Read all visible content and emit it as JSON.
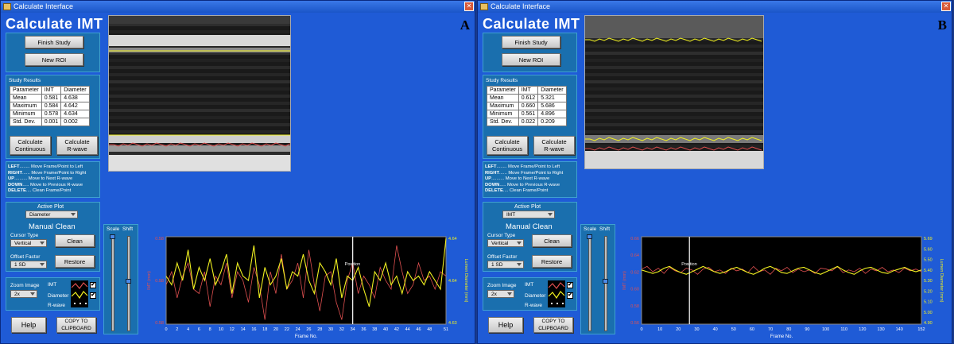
{
  "window": {
    "title": "Calculate Interface",
    "app_title": "Calculate IMT",
    "close_glyph": "✕"
  },
  "controls": {
    "finish_study": "Finish Study",
    "new_roi": "New ROI",
    "study_results": "Study Results",
    "calc_continuous_1": "Calculate",
    "calc_continuous_2": "Continuous",
    "calc_rwave_1": "Calculate",
    "calc_rwave_2": "R-wave",
    "active_plot": "Active Plot",
    "manual_clean": "Manual Clean",
    "cursor_type": "Cursor Type",
    "cursor_value": "Vertical",
    "clean": "Clean",
    "offset_factor": "Offset Factor",
    "offset_value": "1 SD",
    "restore": "Restore",
    "zoom_image": "Zoom Image",
    "zoom_value": "2x",
    "legend_imt": "IMT",
    "legend_diameter": "Diameter",
    "legend_rwave": "R-wave",
    "help": "Help",
    "copy_1": "COPY TO",
    "copy_2": "CLIPBOARD",
    "scale": "Scale",
    "shift": "Shift",
    "frame_label": "Frame No.",
    "imt_axis": "IMT (mm)",
    "lumen_axis": "Lumen Diameter (mm)",
    "position": "Position",
    "check": "✔"
  },
  "keys": [
    {
      "k": "LEFT",
      "d": "........ Move Frame/Point to Left"
    },
    {
      "k": "RIGHT",
      "d": "...... Move Frame/Point to Right"
    },
    {
      "k": "UP",
      "d": ".......... Move to Next R-wave"
    },
    {
      "k": "DOWN",
      "d": "..... Move to Previous R-wave"
    },
    {
      "k": "DELETE",
      "d": ".... Clean Frame/Point"
    }
  ],
  "colors": {
    "imt": "#e05050",
    "diameter": "#f0f020",
    "rwave": "#ffffff",
    "plot_bg": "#000000"
  },
  "panels": [
    {
      "letter": "A",
      "results_header": [
        "Parameter",
        "IMT",
        "Diameter"
      ],
      "results": [
        [
          "Mean",
          "0.581",
          "4.638"
        ],
        [
          "Maximum",
          "0.584",
          "4.642"
        ],
        [
          "Minimum",
          "0.578",
          "4.634"
        ],
        [
          "Std. Dev.",
          "0.001",
          "0.002"
        ]
      ],
      "active_plot_value": "Diameter",
      "chart_data": {
        "type": "line",
        "xlabel": "Frame No.",
        "ylabel": "IMT (mm)",
        "y2label": "Lumen Diameter (mm)",
        "xlim": [
          0,
          51
        ],
        "ylim": [
          0.58,
          0.58
        ],
        "y_ticks_left": [
          "0.58",
          "0.58",
          "0.58"
        ],
        "y_ticks_right": [
          "4.64",
          "4.64",
          "4.63"
        ],
        "x_ticks": [
          0,
          2,
          4,
          6,
          8,
          10,
          12,
          14,
          16,
          18,
          20,
          22,
          24,
          26,
          28,
          30,
          32,
          34,
          36,
          38,
          40,
          42,
          44,
          46,
          48,
          51
        ],
        "cursor_x": 34,
        "series": [
          {
            "name": "IMT",
            "color": "#e05050",
            "values": [
              0.45,
              0.6,
              0.3,
              0.55,
              0.7,
              0.4,
              0.35,
              0.6,
              0.2,
              0.55,
              0.45,
              0.7,
              0.3,
              0.6,
              0.5,
              0.25,
              0.65,
              0.45,
              0.05,
              0.6,
              0.35,
              0.8,
              0.4,
              0.5,
              0.7,
              0.3,
              0.85,
              0.45,
              0.15,
              0.55,
              0.6,
              0.25,
              0.05,
              0.5,
              0.7,
              0.35,
              0.55,
              0.45,
              0.3,
              0.65,
              0.5,
              0.4,
              0.9,
              0.6,
              0.35,
              0.45,
              0.7,
              0.5,
              0.55,
              0.4,
              0.6,
              0.55
            ]
          },
          {
            "name": "Diameter",
            "color": "#f0f020",
            "values": [
              0.55,
              0.45,
              0.7,
              0.5,
              0.85,
              0.4,
              0.65,
              0.5,
              0.75,
              0.45,
              0.6,
              0.8,
              0.35,
              0.7,
              0.55,
              0.5,
              0.9,
              0.3,
              0.65,
              0.45,
              0.55,
              0.75,
              0.4,
              0.6,
              0.55,
              0.8,
              0.5,
              0.35,
              0.7,
              0.6,
              0.45,
              0.75,
              0.3,
              0.55,
              0.5,
              0.65,
              0.4,
              0.2,
              0.6,
              0.5,
              0.7,
              0.45,
              0.55,
              0.35,
              0.6,
              0.5,
              0.55,
              0.45,
              0.6,
              0.5,
              0.4,
              0.98
            ]
          }
        ]
      }
    },
    {
      "letter": "B",
      "results_header": [
        "Parameter",
        "IMT",
        "Diameter"
      ],
      "results": [
        [
          "Mean",
          "0.612",
          "5.321"
        ],
        [
          "Maximum",
          "0.660",
          "5.686"
        ],
        [
          "Minimum",
          "0.561",
          "4.896"
        ],
        [
          "Std. Dev.",
          "0.022",
          "0.209"
        ]
      ],
      "active_plot_value": "IMT",
      "chart_data": {
        "type": "line",
        "xlabel": "Frame No.",
        "ylabel": "IMT (mm)",
        "y2label": "Lumen Diameter (mm)",
        "xlim": [
          0,
          152
        ],
        "ylim": [
          0.56,
          0.66
        ],
        "y_ticks_left": [
          "0.66",
          "0.64",
          "0.62",
          "0.60",
          "0.58",
          "0.56"
        ],
        "y_ticks_right": [
          "5.69",
          "5.60",
          "5.50",
          "5.40",
          "5.30",
          "5.20",
          "5.10",
          "5.00",
          "4.90"
        ],
        "x_ticks": [
          0,
          10,
          20,
          30,
          40,
          50,
          60,
          70,
          80,
          90,
          100,
          110,
          120,
          130,
          140,
          152
        ],
        "cursor_x": 26,
        "series": [
          {
            "name": "IMT",
            "color": "#e05050",
            "values": [
              0.63,
              0.66,
              0.6,
              0.64,
              0.58,
              0.65,
              0.61,
              0.59,
              0.64,
              0.62,
              0.57,
              0.63,
              0.65,
              0.6,
              0.62,
              0.58,
              0.64,
              0.61,
              0.63,
              0.59,
              0.66,
              0.6,
              0.62,
              0.57,
              0.64,
              0.61,
              0.65,
              0.59,
              0.63,
              0.6,
              0.62,
              0.58,
              0.64,
              0.63,
              0.61,
              0.66,
              0.59,
              0.62,
              0.6,
              0.64,
              0.58,
              0.63,
              0.61,
              0.65,
              0.6,
              0.62,
              0.59,
              0.64,
              0.61,
              0.63,
              0.6
            ]
          },
          {
            "name": "Diameter",
            "color": "#f0f020",
            "values": [
              0.62,
              0.6,
              0.58,
              0.6,
              0.64,
              0.66,
              0.62,
              0.59,
              0.57,
              0.6,
              0.63,
              0.66,
              0.63,
              0.6,
              0.58,
              0.6,
              0.63,
              0.65,
              0.62,
              0.59,
              0.57,
              0.6,
              0.64,
              0.66,
              0.63,
              0.59,
              0.58,
              0.61,
              0.64,
              0.65,
              0.62,
              0.59,
              0.57,
              0.6,
              0.63,
              0.66,
              0.62,
              0.59,
              0.57,
              0.61,
              0.64,
              0.65,
              0.62,
              0.59,
              0.58,
              0.61,
              0.63,
              0.65,
              0.62,
              0.6,
              0.62
            ]
          }
        ]
      }
    }
  ]
}
